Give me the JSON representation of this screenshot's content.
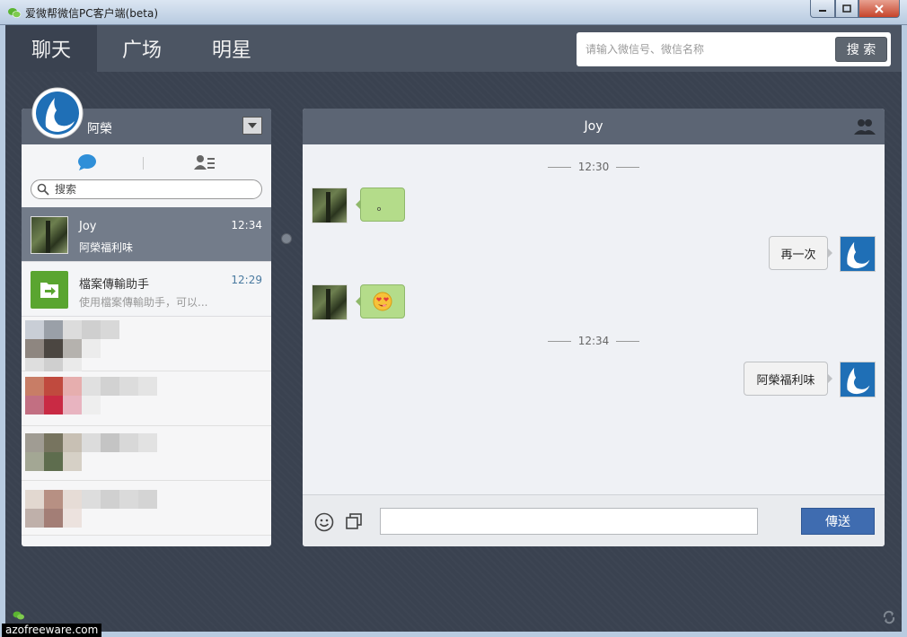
{
  "window": {
    "title": "爱微帮微信PC客户端(beta)"
  },
  "nav": {
    "tabs": [
      "聊天",
      "广场",
      "明星"
    ]
  },
  "search": {
    "placeholder": "请输入微信号、微信名称",
    "button": "搜 索"
  },
  "profile": {
    "name": "阿榮"
  },
  "sidebar": {
    "search_placeholder": "搜索"
  },
  "conversations": [
    {
      "name": "Joy",
      "preview": "阿榮福利味",
      "time": "12:34"
    },
    {
      "name": "檔案傳輸助手",
      "preview": "使用檔案傳輸助手，可以...",
      "time": "12:29"
    }
  ],
  "chat": {
    "title": "Joy",
    "separators": [
      "12:30",
      "12:34"
    ],
    "messages": [
      {
        "side": "in",
        "text": "。"
      },
      {
        "side": "out",
        "text": "再一次"
      },
      {
        "side": "in",
        "text": ""
      },
      {
        "side": "out",
        "text": "阿榮福利味"
      }
    ],
    "send_label": "傳送"
  },
  "icons": {
    "chat": "speech-bubble-icon",
    "contacts": "contacts-list-icon",
    "people": "people-icon",
    "emoji": "smiley-icon",
    "copy": "copy-icon",
    "sticker": "love-emoji-icon"
  },
  "colors": {
    "accent": "#3f6cb0",
    "header": "#5c6574",
    "incoming_bubble": "#b4dc8a",
    "chat_icon": "#2f8fd8"
  },
  "watermark": "azofreeware.com"
}
